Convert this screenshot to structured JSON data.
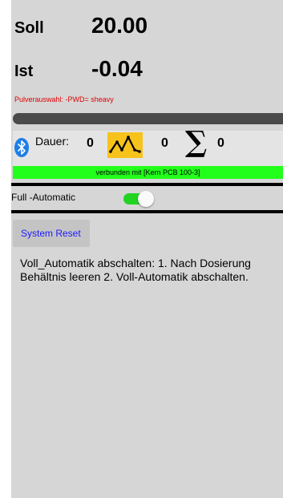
{
  "weights": {
    "soll_label": "Soll",
    "soll_value": "20.00",
    "ist_label": "Ist",
    "ist_value": "-0.04"
  },
  "powder_selection": "Pulverauswahl: -PWD= sheavy",
  "status": {
    "bluetooth_icon": "bluetooth-icon",
    "dauer_label": "Dauer:",
    "dauer_value": "0",
    "graph_icon": "weight-graph-icon",
    "count_value": "0",
    "sum_icon": "sigma-icon",
    "sum_value": "0",
    "connection_text": "verbunden mit [Kern PCB 100-3]"
  },
  "full_automatic": {
    "label": "Full -Automatic",
    "enabled": true
  },
  "reset_button_label": "System Reset",
  "instructions": "Voll_Automatik abschalten: 1. Nach Dosierung Behältnis leeren 2. Voll-Automatik abschalten.",
  "colors": {
    "background": "#d6d6d6",
    "connected": "#22ff1a",
    "toggle_on": "#22d322",
    "graph_icon_bg": "#f7c21b",
    "powder_text": "#e00000",
    "reset_text": "#1a1aff",
    "bluetooth": "#1e7ee6"
  }
}
